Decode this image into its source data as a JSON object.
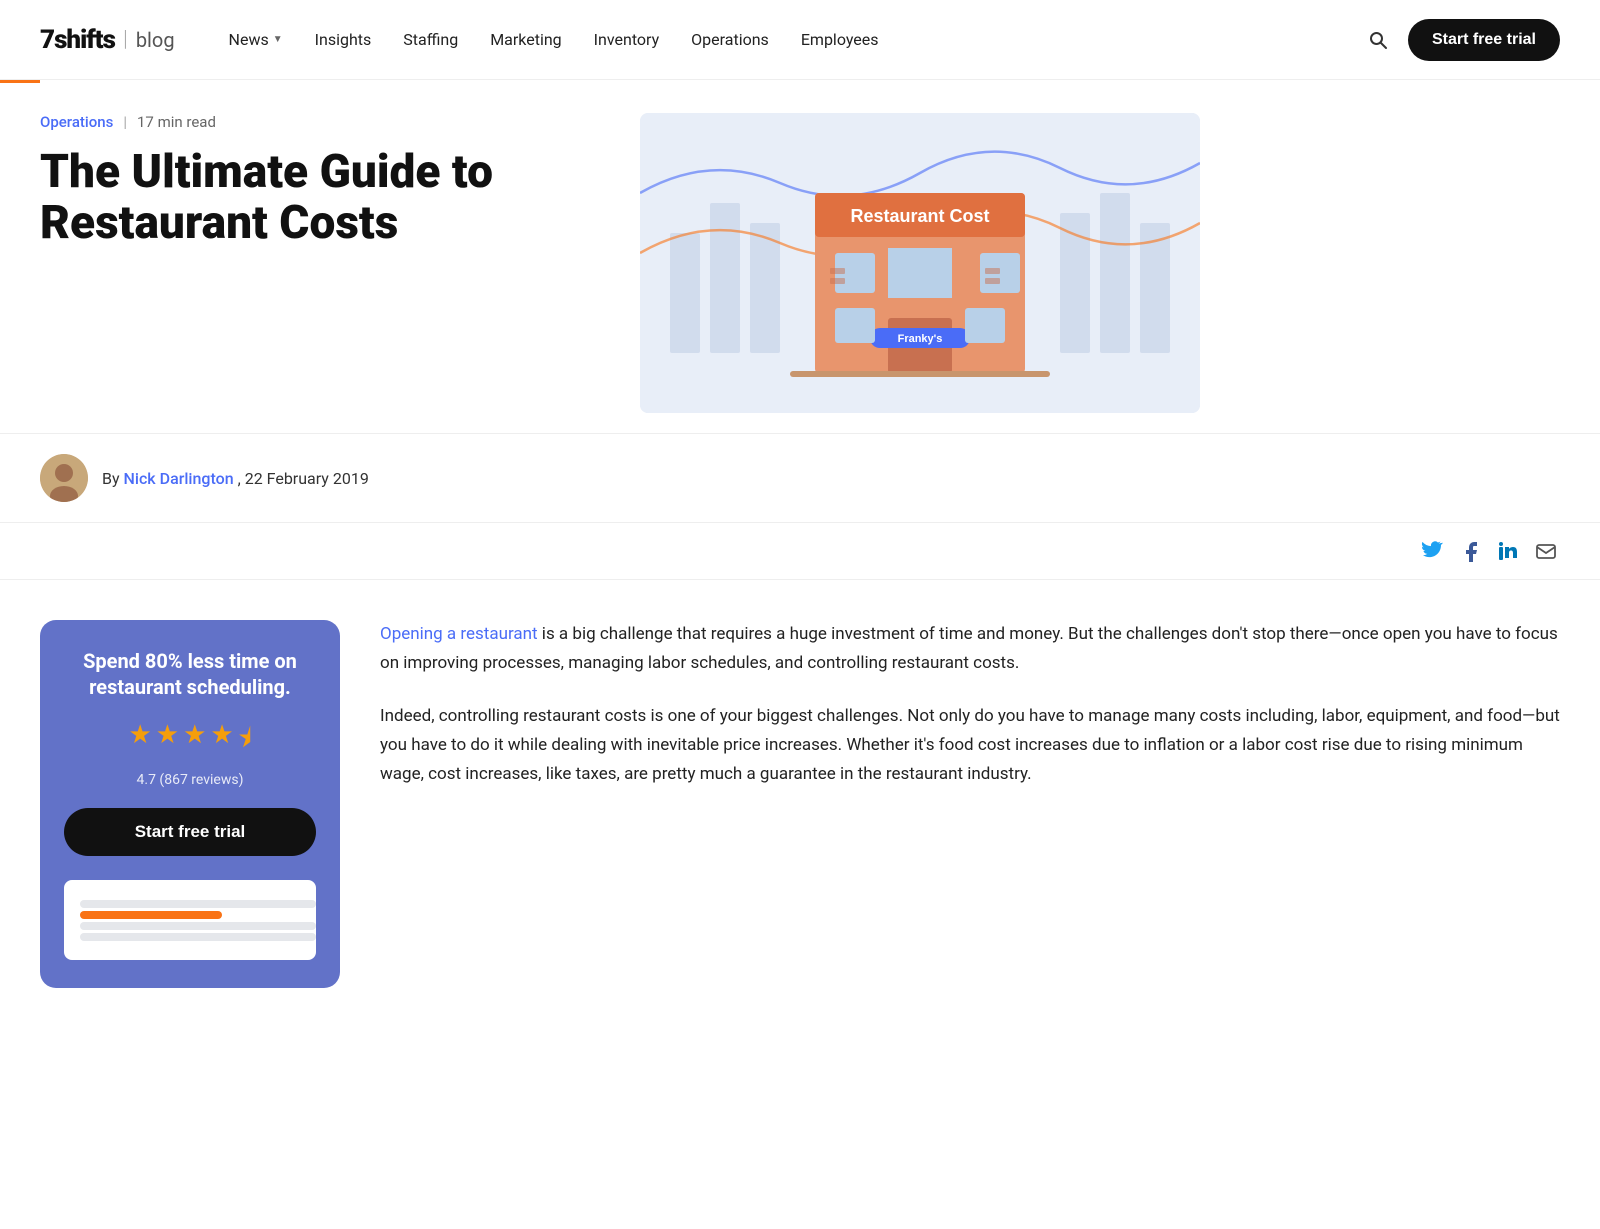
{
  "header": {
    "logo": "7shifts",
    "logo_divider": "|",
    "logo_blog": "blog",
    "nav_items": [
      {
        "label": "News",
        "has_dropdown": true
      },
      {
        "label": "Insights",
        "has_dropdown": false
      },
      {
        "label": "Staffing",
        "has_dropdown": false
      },
      {
        "label": "Marketing",
        "has_dropdown": false
      },
      {
        "label": "Inventory",
        "has_dropdown": false
      },
      {
        "label": "Operations",
        "has_dropdown": false
      },
      {
        "label": "Employees",
        "has_dropdown": false
      }
    ],
    "cta_label": "Start free trial"
  },
  "article": {
    "category": "Operations",
    "read_time": "17 min read",
    "title_line1": "The Ultimate Guide to",
    "title_line2": "Restaurant Costs",
    "author_name": "Nick Darlington",
    "author_prefix": "By",
    "author_date": ", 22 February 2019"
  },
  "sidebar": {
    "cta_title": "Spend 80% less time on restaurant scheduling.",
    "rating": "4.7 (867 reviews)",
    "cta_btn": "Start free trial",
    "stars": [
      {
        "type": "full"
      },
      {
        "type": "full"
      },
      {
        "type": "full"
      },
      {
        "type": "full"
      },
      {
        "type": "half"
      }
    ]
  },
  "body": {
    "link_text": "Opening a restaurant",
    "paragraph1": " is a big challenge that requires a huge investment of time and money. But the challenges don't stop there—once open you have to focus on improving processes, managing labor schedules, and controlling restaurant costs.",
    "paragraph2": "Indeed, controlling restaurant costs is one of your biggest challenges. Not only do you have to manage many costs including, labor, equipment, and food—but you have to do it while dealing with inevitable price increases. Whether it's food cost increases due to inflation or a labor cost rise due to rising minimum wage, cost increases, like taxes, are pretty much a guarantee in the restaurant industry."
  },
  "social": {
    "twitter": "𝕏",
    "facebook": "f",
    "linkedin": "in",
    "email": "✉"
  },
  "hero": {
    "building_label": "Restaurant Cost",
    "restaurant_name": "Franky's"
  }
}
